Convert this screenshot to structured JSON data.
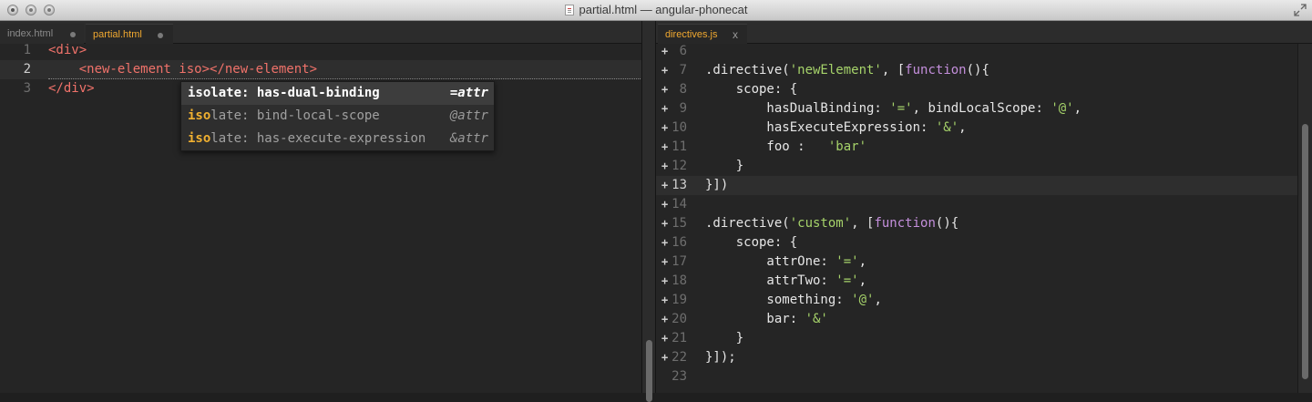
{
  "window": {
    "title": "partial.html — angular-phonecat"
  },
  "left_pane": {
    "tabs": [
      {
        "label": "index.html",
        "active": false
      },
      {
        "label": "partial.html",
        "active": true
      }
    ],
    "lines": [
      {
        "num": "1",
        "code": "<div>"
      },
      {
        "num": "2",
        "code": "    <new-element iso></new-element>"
      },
      {
        "num": "3",
        "code": "</div>"
      }
    ],
    "line2_parts": {
      "indent": "    ",
      "open_tag": "<new-element",
      "attr": " iso",
      "rest": "></new-element>"
    },
    "autocomplete": [
      {
        "match": "iso",
        "rest": "late: has-dual-binding",
        "hint": "=attr",
        "selected": true
      },
      {
        "match": "iso",
        "rest": "late: bind-local-scope",
        "hint": "@attr",
        "selected": false
      },
      {
        "match": "iso",
        "rest": "late: has-execute-expression",
        "hint": "&attr",
        "selected": false
      }
    ]
  },
  "right_pane": {
    "tabs": [
      {
        "label": "directives.js",
        "active": true,
        "close": "x"
      }
    ],
    "lines": [
      {
        "num": "6"
      },
      {
        "num": "7",
        "p": [
          [
            ".directive(",
            "t-punc"
          ],
          [
            "'newElement'",
            "t-str"
          ],
          [
            ", [",
            "t-punc"
          ],
          [
            "function",
            "t-kw"
          ],
          [
            "(){",
            "t-punc"
          ]
        ]
      },
      {
        "num": "8",
        "p": [
          [
            "    scope: {",
            "t-punc"
          ]
        ]
      },
      {
        "num": "9",
        "p": [
          [
            "        hasDualBinding: ",
            "t-punc"
          ],
          [
            "'='",
            "t-str"
          ],
          [
            ", bindLocalScope: ",
            "t-punc"
          ],
          [
            "'@'",
            "t-str"
          ],
          [
            ",",
            "t-punc"
          ]
        ]
      },
      {
        "num": "10",
        "p": [
          [
            "        hasExecuteExpression: ",
            "t-punc"
          ],
          [
            "'&'",
            "t-str"
          ],
          [
            ",",
            "t-punc"
          ]
        ]
      },
      {
        "num": "11",
        "p": [
          [
            "        foo :   ",
            "t-punc"
          ],
          [
            "'bar'",
            "t-str"
          ]
        ]
      },
      {
        "num": "12",
        "p": [
          [
            "    }",
            "t-punc"
          ]
        ]
      },
      {
        "num": "13",
        "p": [
          [
            "}])",
            "t-punc"
          ]
        ],
        "current": true
      },
      {
        "num": "14"
      },
      {
        "num": "15",
        "p": [
          [
            ".directive(",
            "t-punc"
          ],
          [
            "'custom'",
            "t-str"
          ],
          [
            ", [",
            "t-punc"
          ],
          [
            "function",
            "t-kw"
          ],
          [
            "(){",
            "t-punc"
          ]
        ]
      },
      {
        "num": "16",
        "p": [
          [
            "    scope: {",
            "t-punc"
          ]
        ]
      },
      {
        "num": "17",
        "p": [
          [
            "        attrOne: ",
            "t-punc"
          ],
          [
            "'='",
            "t-str"
          ],
          [
            ",",
            "t-punc"
          ]
        ]
      },
      {
        "num": "18",
        "p": [
          [
            "        attrTwo: ",
            "t-punc"
          ],
          [
            "'='",
            "t-str"
          ],
          [
            ",",
            "t-punc"
          ]
        ]
      },
      {
        "num": "19",
        "p": [
          [
            "        something: ",
            "t-punc"
          ],
          [
            "'@'",
            "t-str"
          ],
          [
            ",",
            "t-punc"
          ]
        ]
      },
      {
        "num": "20",
        "p": [
          [
            "        bar: ",
            "t-punc"
          ],
          [
            "'&'",
            "t-str"
          ]
        ]
      },
      {
        "num": "21",
        "p": [
          [
            "    }",
            "t-punc"
          ]
        ]
      },
      {
        "num": "22",
        "p": [
          [
            "}]);",
            "t-punc"
          ]
        ]
      },
      {
        "num": "23",
        "nofold": true
      }
    ]
  },
  "colors": {
    "tab_active": "#f0a830",
    "tag": "#f0726a",
    "string": "#a6d36a",
    "keyword": "#c48fdc",
    "background": "#252525"
  }
}
